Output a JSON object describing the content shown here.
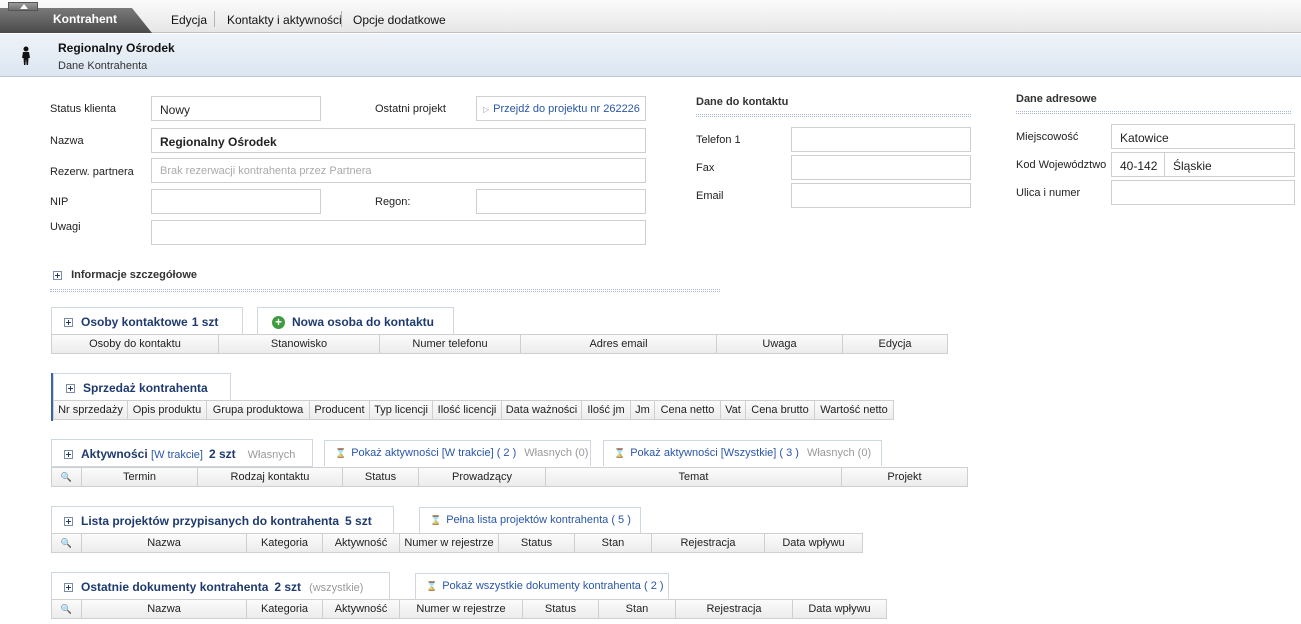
{
  "menu": {
    "active_tab": "Kontrahent",
    "items": [
      "Edycja",
      "Kontakty i aktywności",
      "Opcje dodatkowe"
    ]
  },
  "header": {
    "title": "Regionalny Ośrodek",
    "subtitle": "Dane Kontrahenta"
  },
  "form": {
    "status_label": "Status klienta",
    "status_value": "Nowy",
    "last_project_label": "Ostatni projekt",
    "last_project_link": "Przejdź do projektu nr 262226",
    "name_label": "Nazwa",
    "name_value": "Regionalny Ośrodek",
    "reservation_label": "Rezerw. partnera",
    "reservation_placeholder": "Brak rezerwacji kontrahenta przez Partnera",
    "nip_label": "NIP",
    "nip_value": "",
    "regon_label": "Regon:",
    "regon_value": "",
    "notes_label": "Uwagi",
    "notes_value": ""
  },
  "contact": {
    "title": "Dane do kontaktu",
    "phone_label": "Telefon 1",
    "phone_value": "",
    "fax_label": "Fax",
    "fax_value": "",
    "email_label": "Email",
    "email_value": ""
  },
  "address": {
    "title": "Dane adresowe",
    "city_label": "Miejscowość",
    "city_value": "Katowice",
    "zip_label": "Kod Województwo",
    "zip_value": "40-142",
    "province_value": "Śląskie",
    "street_label": "Ulica i numer",
    "street_value": ""
  },
  "details": {
    "title": "Informacje szczegółowe"
  },
  "contacts_section": {
    "title": "Osoby kontaktowe",
    "count": "1 szt",
    "new_button": "Nowa osoba do kontaktu",
    "columns": [
      "Osoby do kontaktu",
      "Stanowisko",
      "Numer telefonu",
      "Adres email",
      "Uwaga",
      "Edycja"
    ]
  },
  "sales_section": {
    "title": "Sprzedaż kontrahenta",
    "columns": [
      "Nr sprzedaży",
      "Opis produktu",
      "Grupa produktowa",
      "Producent",
      "Typ licencji",
      "Ilość licencji",
      "Data ważności",
      "Ilość jm",
      "Jm",
      "Cena netto",
      "Vat",
      "Cena brutto",
      "Wartość netto"
    ]
  },
  "activities_section": {
    "title": "Aktywności",
    "filter": "[W trakcie]",
    "count": "2 szt",
    "own": "Własnych",
    "tab1_label": "Pokaż aktywności [W trakcie] ( 2 )",
    "tab1_own": "Własnych (0)",
    "tab2_label": "Pokaż aktywności [Wszystkie] ( 3 )",
    "tab2_own": "Własnych (0)",
    "columns": [
      "Termin",
      "Rodzaj kontaktu",
      "Status",
      "Prowadzący",
      "Temat",
      "Projekt"
    ]
  },
  "projects_section": {
    "title": "Lista projektów przypisanych do kontrahenta",
    "count": "5 szt",
    "tab_label": "Pełna lista projektów kontrahenta ( 5 )",
    "columns": [
      "Nazwa",
      "Kategoria",
      "Aktywność",
      "Numer w rejestrze",
      "Status",
      "Stan",
      "Rejestracja",
      "Data wpływu"
    ]
  },
  "documents_section": {
    "title": "Ostatnie dokumenty kontrahenta",
    "count": "2 szt",
    "scope": "(wszystkie)",
    "tab_label": "Pokaż wszystkie dokumenty kontrahenta ( 2 )",
    "columns": [
      "Nazwa",
      "Kategoria",
      "Aktywność",
      "Numer w rejestrze",
      "Status",
      "Stan",
      "Rejestracja",
      "Data wpływu"
    ]
  }
}
